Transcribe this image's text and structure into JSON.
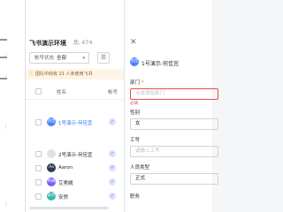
{
  "left_strip": {
    "dots": "⋮"
  },
  "header": {
    "title": "飞书演示环境",
    "member_count": "474"
  },
  "filter": {
    "label": "帐号状态",
    "value": "全部"
  },
  "banner": {
    "text": "团队中尚有 21 人未使用飞书"
  },
  "table": {
    "columns": {
      "name": "姓名",
      "account": "帐号"
    },
    "rows": [
      {
        "name": "1号演示-何佳宜",
        "avatar": "何佳",
        "avatar_color": "#4e83fd",
        "selected": true
      },
      {
        "name": "2号演示-何佳宜",
        "avatar": "",
        "avatar_color": "#dfe1e5",
        "selected": false
      },
      {
        "name": "Aaron",
        "avatar": "Aa",
        "avatar_color": "#2f3a4c",
        "selected": false
      },
      {
        "name": "艾男娲",
        "avatar": "男娲",
        "avatar_color": "#7c5cfc",
        "selected": false
      },
      {
        "name": "安然",
        "avatar": "安然",
        "avatar_color": "#35b6ae",
        "selected": false
      }
    ]
  },
  "panel": {
    "user_name": "1号演示-何佳宜",
    "user_avatar": "何佳",
    "dept_label": "部门",
    "dept_placeholder": "点击添加部门",
    "dept_error": "必填",
    "gender_label": "性别",
    "gender_value": "女",
    "employee_id_label": "工号",
    "employee_id_placeholder": "请输入工号",
    "staff_type_label": "人员类型",
    "staff_type_value": "正式",
    "job_label": "职务"
  },
  "colors": {
    "accent": "#3370ff",
    "error": "#f54a45",
    "warning_bg": "#fef4e7"
  }
}
